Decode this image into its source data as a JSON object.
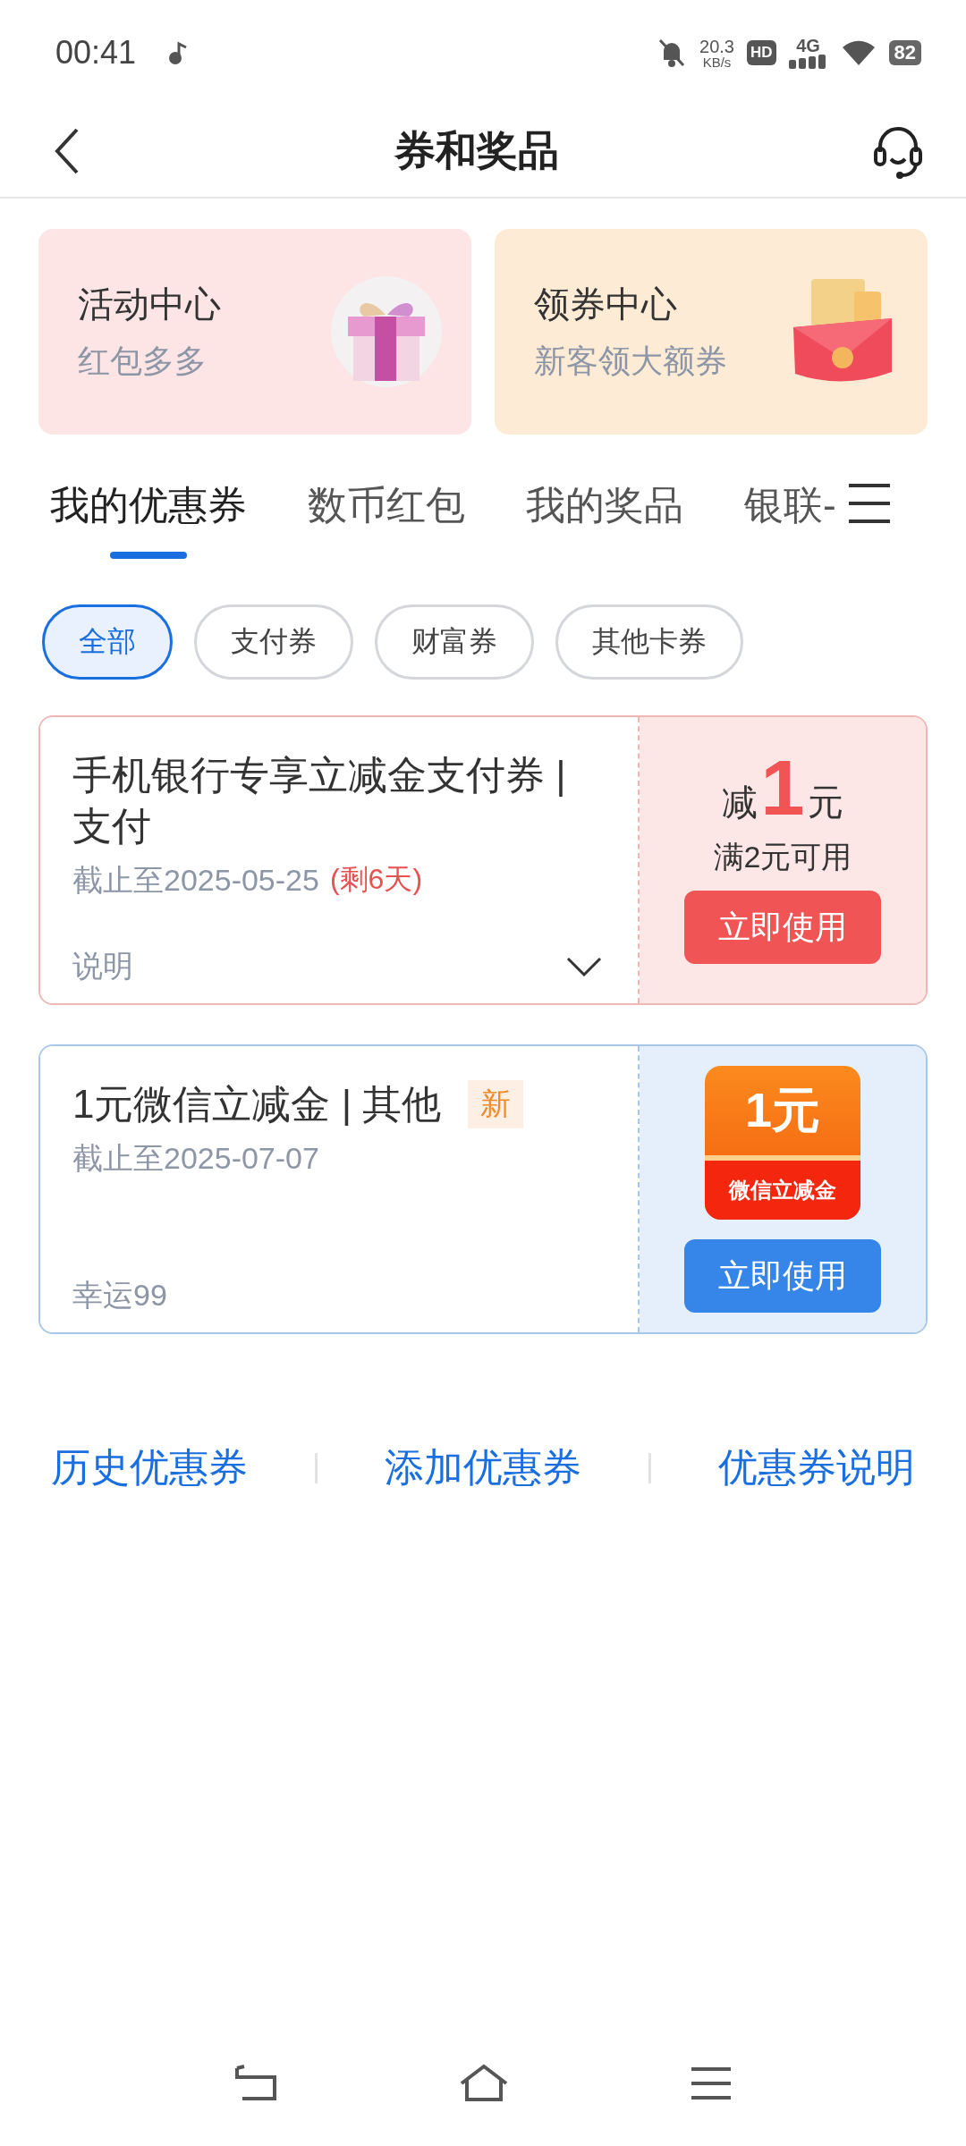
{
  "status_bar": {
    "time": "00:41",
    "net_speed": "20.3",
    "net_unit": "KB/s",
    "hd": "HD",
    "network": "4G",
    "battery": "82"
  },
  "header": {
    "title": "券和奖品"
  },
  "banners": [
    {
      "kind": "gift",
      "title": "活动中心",
      "subtitle": "红包多多",
      "color": "#fde5e5"
    },
    {
      "kind": "envelope",
      "title": "领券中心",
      "subtitle": "新客领大额券",
      "color": "#fdebd6"
    }
  ],
  "tabs": [
    {
      "label": "我的优惠券",
      "selected": true
    },
    {
      "label": "数币红包",
      "selected": false
    },
    {
      "label": "我的奖品",
      "selected": false
    },
    {
      "label": "银联-",
      "selected": false
    }
  ],
  "chips": [
    {
      "label": "全部",
      "selected": true
    },
    {
      "label": "支付券",
      "selected": false
    },
    {
      "label": "财富券",
      "selected": false
    },
    {
      "label": "其他卡券",
      "selected": false
    }
  ],
  "coupons": [
    {
      "kind": "discount",
      "title": "手机银行专享立减金支付券 | 支付",
      "deadline": "截止至2025-05-25",
      "remaining": "(剩6天)",
      "note": "说明",
      "prefix": "减",
      "amount": "1",
      "unit": "元",
      "condition": "满2元可用",
      "button": "立即使用"
    },
    {
      "kind": "voucher",
      "title": "1元微信立减金 | 其他",
      "badge": "新",
      "deadline": "截止至2025-07-07",
      "note": "幸运99",
      "image_amount": "1元",
      "image_caption": "微信立减金",
      "button": "立即使用"
    }
  ],
  "links": [
    "历史优惠券",
    "添加优惠券",
    "优惠券说明"
  ]
}
